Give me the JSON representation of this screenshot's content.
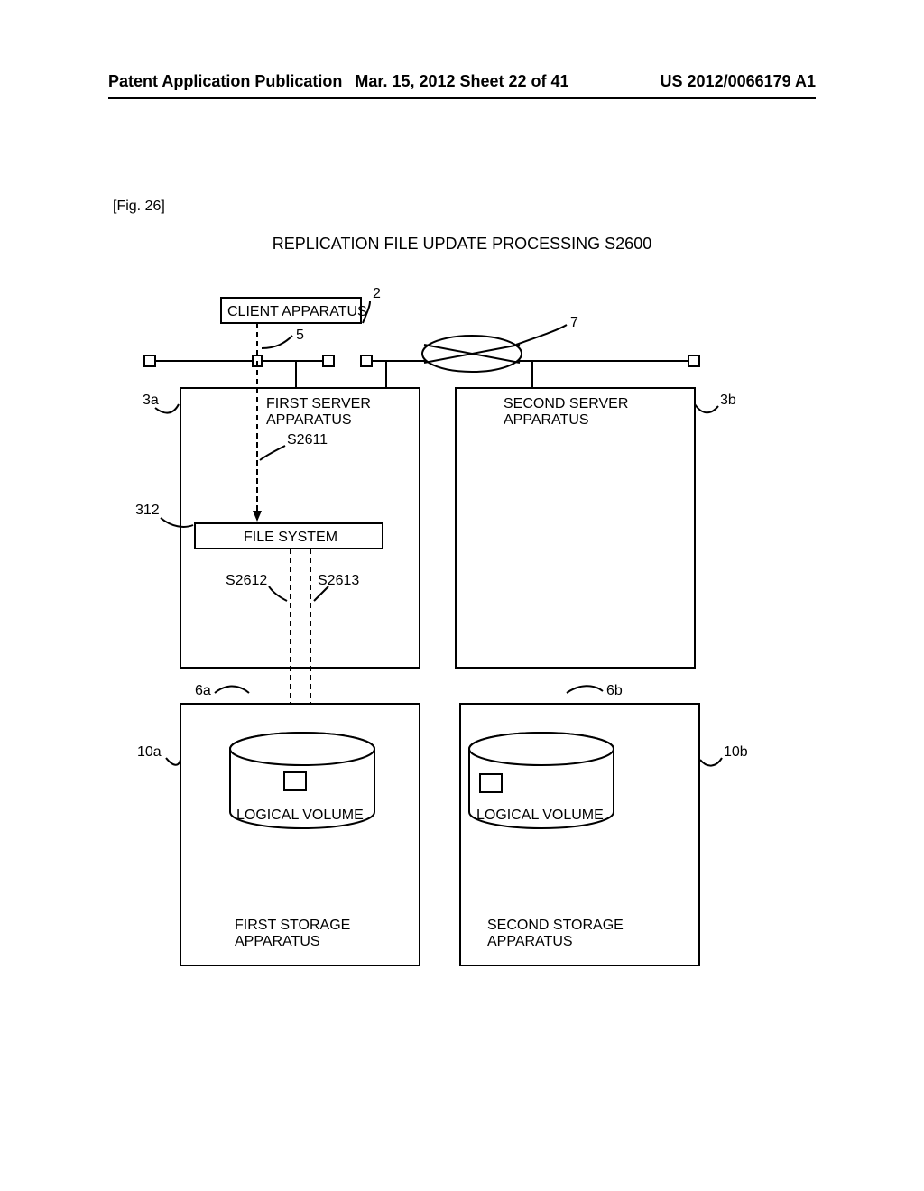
{
  "header": {
    "left": "Patent Application Publication",
    "mid": "Mar. 15, 2012  Sheet 22 of 41",
    "right": "US 2012/0066179 A1"
  },
  "fig_label": "[Fig. 26]",
  "title": "REPLICATION FILE UPDATE PROCESSING  S2600",
  "labels": {
    "client": "CLIENT APPARATUS",
    "first_server_l1": "FIRST SERVER",
    "first_server_l2": "APPARATUS",
    "second_server_l1": "SECOND SERVER",
    "second_server_l2": "APPARATUS",
    "file_system": "FILE SYSTEM",
    "logical_volume": "LOGICAL VOLUME",
    "logical_volume_b": "LOGICAL VOLUME",
    "first_storage_l1": "FIRST STORAGE",
    "first_storage_l2": "APPARATUS",
    "second_storage_l1": "SECOND STORAGE",
    "second_storage_l2": "APPARATUS"
  },
  "refs": {
    "r2": "2",
    "r5": "5",
    "r7": "7",
    "r3a": "3a",
    "r3b": "3b",
    "r312": "312",
    "r6a": "6a",
    "r6b": "6b",
    "r10a": "10a",
    "r10b": "10b",
    "s2611": "S2611",
    "s2612": "S2612",
    "s2613": "S2613"
  }
}
